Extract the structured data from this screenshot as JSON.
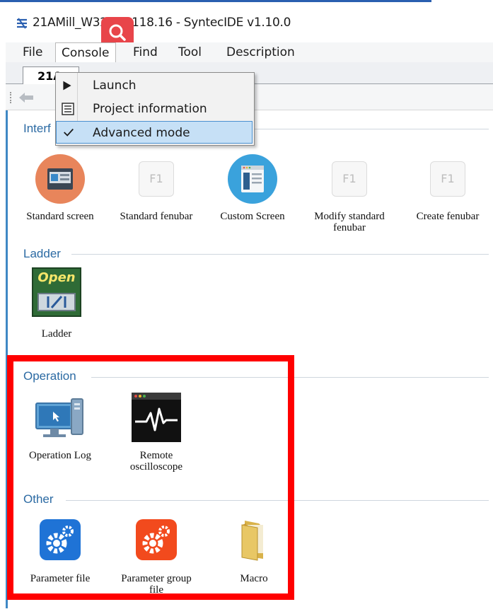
{
  "window": {
    "title": "21AMill_W32_10.118.16 - SyntecIDE v1.10.0"
  },
  "menubar": {
    "items": [
      "File",
      "Console",
      "Find",
      "Tool",
      "Description"
    ]
  },
  "document_tab": {
    "label": "21A"
  },
  "console_menu": {
    "items": [
      {
        "label": "Launch",
        "icon": "play-icon"
      },
      {
        "label": "Project information",
        "icon": "list-icon"
      },
      {
        "label": "Advanced mode",
        "icon": "checkmark-icon",
        "checked": true,
        "highlighted": true
      }
    ]
  },
  "sections": {
    "interface": {
      "heading": "Interf",
      "tiles": [
        {
          "label": "Standard screen",
          "icon": "screen-icon"
        },
        {
          "label": "Standard fenubar",
          "icon": "f1-key-icon",
          "glyph": "F1"
        },
        {
          "label": "Custom Screen",
          "icon": "custom-screen-icon"
        },
        {
          "label": "Modify standard fenubar",
          "icon": "f1-key-icon",
          "glyph": "F1"
        },
        {
          "label": "Create fenubar",
          "icon": "f1-key-icon",
          "glyph": "F1"
        }
      ]
    },
    "ladder": {
      "heading": "Ladder",
      "tiles": [
        {
          "label": "Ladder",
          "icon": "ladder-icon",
          "badge_text": "Open"
        }
      ]
    },
    "operation": {
      "heading": "Operation",
      "tiles": [
        {
          "label": "Operation Log",
          "icon": "computer-log-icon"
        },
        {
          "label": "Remote oscilloscope",
          "icon": "oscilloscope-icon"
        }
      ]
    },
    "other": {
      "heading": "Other",
      "tiles": [
        {
          "label": "Parameter file",
          "icon": "gear-blue-icon"
        },
        {
          "label": "Parameter group file",
          "icon": "gear-orange-icon"
        },
        {
          "label": "Macro",
          "icon": "folder-icon"
        }
      ]
    }
  },
  "colors": {
    "section_heading": "#2b6aa3",
    "highlight_border": "#ff0000",
    "menu_highlight": "#c6e0f6"
  }
}
